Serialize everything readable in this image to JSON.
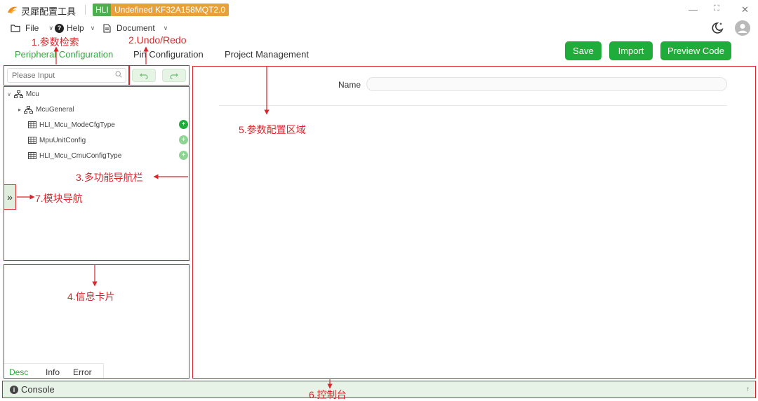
{
  "titlebar": {
    "app_name": "灵犀配置工具",
    "hli_badge": "HLI",
    "chip_badge": "Undefined KF32A158MQT2.0",
    "min": "—",
    "max": "⛶",
    "close": "✕"
  },
  "menu": {
    "file": "File",
    "help": "Help",
    "document": "Document"
  },
  "tabs": {
    "peripheral": "Peripheral Configuration",
    "pin": "Pin Configuration",
    "project": "Project Management"
  },
  "actions": {
    "save": "Save",
    "import": "Import",
    "preview": "Preview Code"
  },
  "search": {
    "placeholder": "Please Input"
  },
  "tree": {
    "root": "Mcu",
    "items": [
      {
        "label": "McuGeneral"
      },
      {
        "label": "HLI_Mcu_ModeCfgType"
      },
      {
        "label": "MpuUnitConfig"
      },
      {
        "label": "HLI_Mcu_CmuConfigType"
      }
    ]
  },
  "info_card": {
    "tabs": [
      "Desc",
      "Info",
      "Error"
    ]
  },
  "config": {
    "name_label": "Name"
  },
  "console": {
    "label": "Console"
  },
  "annotations": {
    "a1": "1.参数检索",
    "a2": "2.Undo/Redo",
    "a3": "3.多功能导航栏",
    "a4": "4.信息卡片",
    "a5": "5.参数配置区域",
    "a6": "6.控制台",
    "a7": "7.模块导航"
  },
  "colors": {
    "accent_green": "#1fac3a",
    "annotation_red": "#d9262c",
    "chip_orange": "#e7a13a"
  }
}
